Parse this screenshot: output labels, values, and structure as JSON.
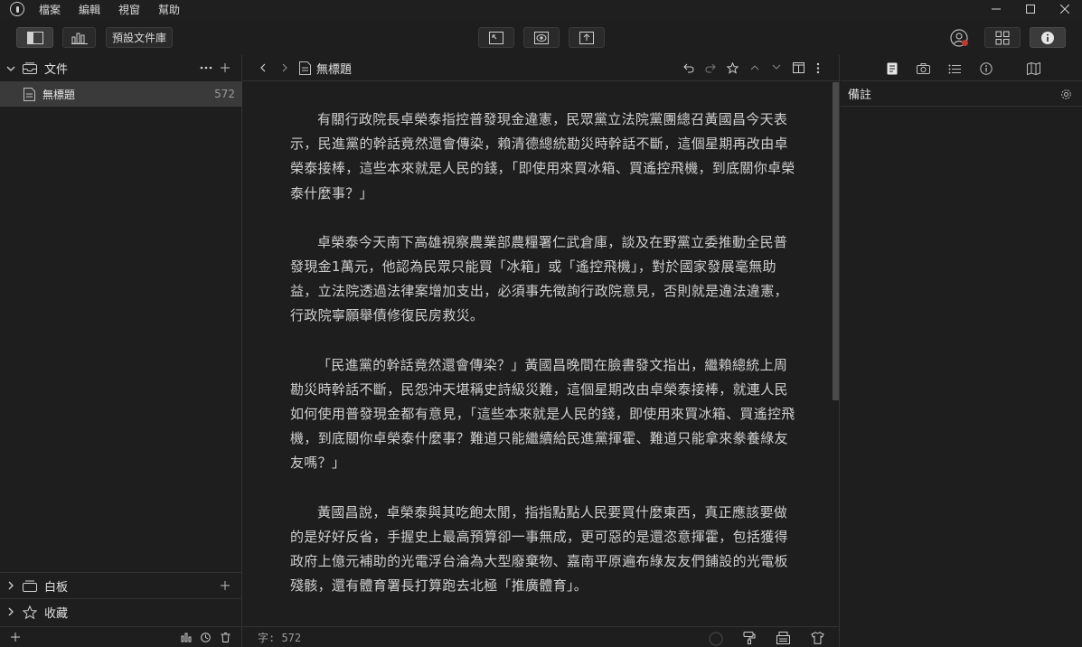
{
  "menubar": {
    "items": [
      "檔案",
      "編輯",
      "視窗",
      "幫助"
    ]
  },
  "toolbar": {
    "library_label": "預設文件庫"
  },
  "sidebar": {
    "files_title": "文件",
    "doc": {
      "name": "無標題",
      "count": "572"
    },
    "whiteboard_title": "白板",
    "favorites_title": "收藏"
  },
  "editor": {
    "title": "無標題",
    "paragraphs": [
      "有關行政院長卓榮泰指控普發現金違憲，民眾黨立法院黨團總召黃國昌今天表示，民進黨的幹話竟然還會傳染，賴清德總統勘災時幹話不斷，這個星期再改由卓榮泰接棒，這些本來就是人民的錢，「即使用來買冰箱、買遙控飛機，到底關你卓榮泰什麼事？」",
      "卓榮泰今天南下高雄視察農業部農糧署仁武倉庫，談及在野黨立委推動全民普發現金1萬元，他認為民眾只能買「冰箱」或「遙控飛機」，對於國家發展毫無助益，立法院透過法律案增加支出，必須事先徵詢行政院意見，否則就是違法違憲，行政院寧願舉債修復民房救災。",
      "「民進黨的幹話竟然還會傳染？」黃國昌晚間在臉書發文指出，繼賴總統上周勘災時幹話不斷，民怨沖天堪稱史詩級災難，這個星期改由卓榮泰接棒，就連人民如何使用普發現金都有意見，「這些本來就是人民的錢，即使用來買冰箱、買遙控飛機，到底關你卓榮泰什麼事？難道只能繼續給民進黨揮霍、難道只能拿來豢養綠友友嗎？」",
      "黃國昌說，卓榮泰與其吃飽太閒，指指點點人民要買什麼東西，真正應該要做的是好好反省，手握史上最高預算卻一事無成，更可惡的是還恣意揮霍，包括獲得政府上億元補助的光電浮台淪為大型廢棄物、嘉南平原遍布綠友友們鋪設的光電板殘骸，還有體育署長打算跑去北極「推廣體育」。"
    ],
    "wordcount": "字: 572"
  },
  "notes": {
    "title": "備註"
  }
}
